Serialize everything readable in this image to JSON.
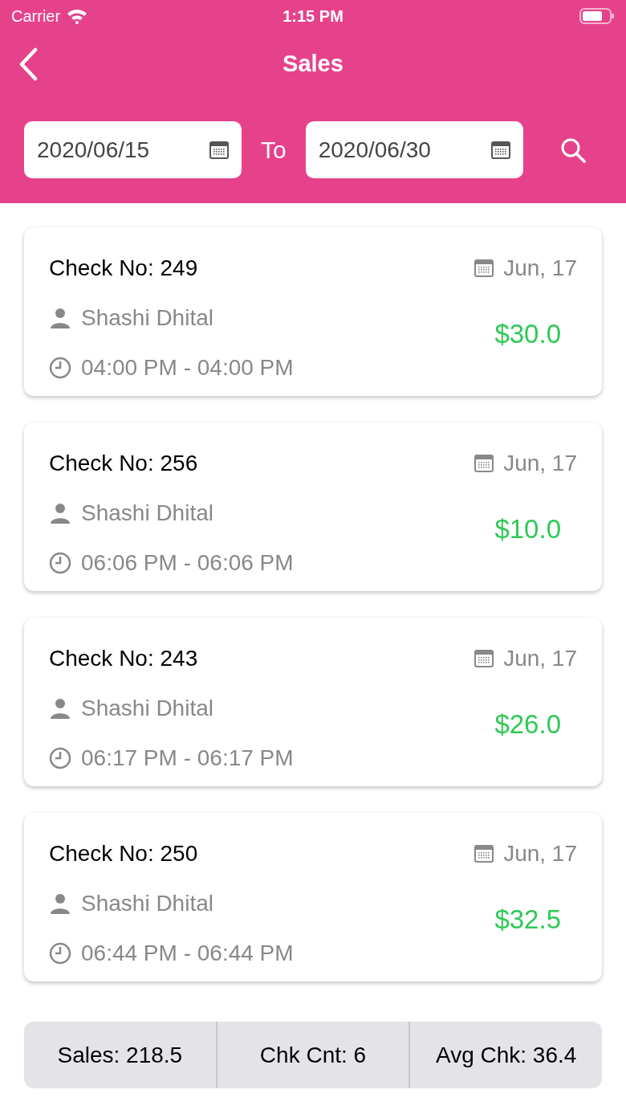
{
  "status_bar": {
    "carrier": "Carrier",
    "time": "1:15 PM"
  },
  "nav": {
    "title": "Sales"
  },
  "filter": {
    "from": "2020/06/15",
    "separator": "To",
    "to": "2020/06/30"
  },
  "checks": [
    {
      "check_no": "Check No: 249",
      "date": "Jun, 17",
      "server": "Shashi Dhital",
      "time": "04:00 PM - 04:00 PM",
      "amount": "$30.0"
    },
    {
      "check_no": "Check No: 256",
      "date": "Jun, 17",
      "server": "Shashi Dhital",
      "time": "06:06 PM - 06:06 PM",
      "amount": "$10.0"
    },
    {
      "check_no": "Check No: 243",
      "date": "Jun, 17",
      "server": "Shashi Dhital",
      "time": "06:17 PM - 06:17 PM",
      "amount": "$26.0"
    },
    {
      "check_no": "Check No: 250",
      "date": "Jun, 17",
      "server": "Shashi Dhital",
      "time": "06:44 PM - 06:44 PM",
      "amount": "$32.5"
    }
  ],
  "summary": [
    "Sales: 218.5",
    "Chk Cnt: 6",
    "Avg Chk: 36.4"
  ]
}
